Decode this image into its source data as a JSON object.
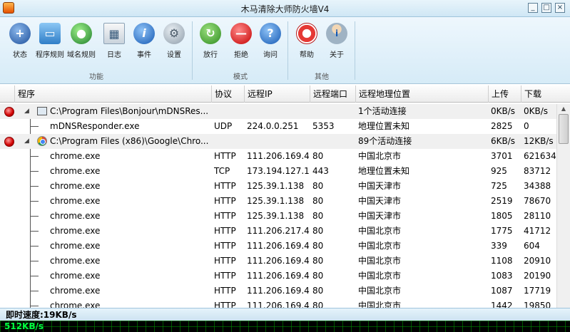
{
  "window": {
    "title": "木马清除大师防火墙V4",
    "minimize": "_",
    "restore": "□",
    "close": "×"
  },
  "toolbar": {
    "groups": [
      {
        "label": "功能",
        "buttons": [
          {
            "label": "状态",
            "icon": "shield-plus-icon"
          },
          {
            "label": "程序规则",
            "icon": "folder-icon"
          },
          {
            "label": "域名规则",
            "icon": "globe-icon"
          },
          {
            "label": "日志",
            "icon": "calendar-icon"
          },
          {
            "label": "事件",
            "icon": "info-icon"
          },
          {
            "label": "设置",
            "icon": "gears-icon"
          }
        ]
      },
      {
        "label": "模式",
        "buttons": [
          {
            "label": "放行",
            "icon": "refresh-green-icon"
          },
          {
            "label": "拒绝",
            "icon": "no-entry-icon"
          },
          {
            "label": "询问",
            "icon": "question-icon"
          }
        ]
      },
      {
        "label": "其他",
        "buttons": [
          {
            "label": "帮助",
            "icon": "lifebuoy-icon"
          },
          {
            "label": "关于",
            "icon": "user-info-icon"
          }
        ]
      }
    ]
  },
  "table": {
    "columns": [
      "程序",
      "协议",
      "远程IP",
      "远程端口",
      "远程地理位置",
      "上传",
      "下载"
    ],
    "rows": [
      {
        "kind": "parent",
        "app": "bonjour",
        "program": "C:\\Program Files\\Bonjour\\mDNSRes...",
        "protocol": "",
        "ip": "",
        "port": "",
        "location": "1个活动连接",
        "up": "0KB/s",
        "down": "0KB/s"
      },
      {
        "kind": "child",
        "program": "mDNSResponder.exe",
        "protocol": "UDP",
        "ip": "224.0.0.251",
        "port": "5353",
        "location": "地理位置未知",
        "up": "2825",
        "down": "0"
      },
      {
        "kind": "parent",
        "app": "chrome",
        "program": "C:\\Program Files (x86)\\Google\\Chro...",
        "protocol": "",
        "ip": "",
        "port": "",
        "location": "89个活动连接",
        "up": "6KB/s",
        "down": "12KB/s"
      },
      {
        "kind": "child",
        "program": "chrome.exe",
        "protocol": "HTTP",
        "ip": "111.206.169.4",
        "port": "80",
        "location": "中国北京市",
        "up": "3701",
        "down": "621634"
      },
      {
        "kind": "child",
        "program": "chrome.exe",
        "protocol": "TCP",
        "ip": "173.194.127.1...",
        "port": "443",
        "location": "地理位置未知",
        "up": "925",
        "down": "83712"
      },
      {
        "kind": "child",
        "program": "chrome.exe",
        "protocol": "HTTP",
        "ip": "125.39.1.138",
        "port": "80",
        "location": "中国天津市",
        "up": "725",
        "down": "34388"
      },
      {
        "kind": "child",
        "program": "chrome.exe",
        "protocol": "HTTP",
        "ip": "125.39.1.138",
        "port": "80",
        "location": "中国天津市",
        "up": "2519",
        "down": "78670"
      },
      {
        "kind": "child",
        "program": "chrome.exe",
        "protocol": "HTTP",
        "ip": "125.39.1.138",
        "port": "80",
        "location": "中国天津市",
        "up": "1805",
        "down": "28110"
      },
      {
        "kind": "child",
        "program": "chrome.exe",
        "protocol": "HTTP",
        "ip": "111.206.217.48",
        "port": "80",
        "location": "中国北京市",
        "up": "1775",
        "down": "41712"
      },
      {
        "kind": "child",
        "program": "chrome.exe",
        "protocol": "HTTP",
        "ip": "111.206.169.4",
        "port": "80",
        "location": "中国北京市",
        "up": "339",
        "down": "604"
      },
      {
        "kind": "child",
        "program": "chrome.exe",
        "protocol": "HTTP",
        "ip": "111.206.169.4",
        "port": "80",
        "location": "中国北京市",
        "up": "1108",
        "down": "20910"
      },
      {
        "kind": "child",
        "program": "chrome.exe",
        "protocol": "HTTP",
        "ip": "111.206.169.4",
        "port": "80",
        "location": "中国北京市",
        "up": "1083",
        "down": "20190"
      },
      {
        "kind": "child",
        "program": "chrome.exe",
        "protocol": "HTTP",
        "ip": "111.206.169.4",
        "port": "80",
        "location": "中国北京市",
        "up": "1087",
        "down": "17719"
      },
      {
        "kind": "child",
        "program": "chrome.exe",
        "protocol": "HTTP",
        "ip": "111.206.169.4",
        "port": "80",
        "location": "中国北京市",
        "up": "1442",
        "down": "19850"
      }
    ]
  },
  "status": {
    "speed": "即时速度:19KB/s"
  },
  "graph": {
    "label": "512KB/s"
  },
  "colors": {
    "accent": "#cfe7f5",
    "graph_bg": "#000000",
    "graph_text": "#00ff40"
  }
}
